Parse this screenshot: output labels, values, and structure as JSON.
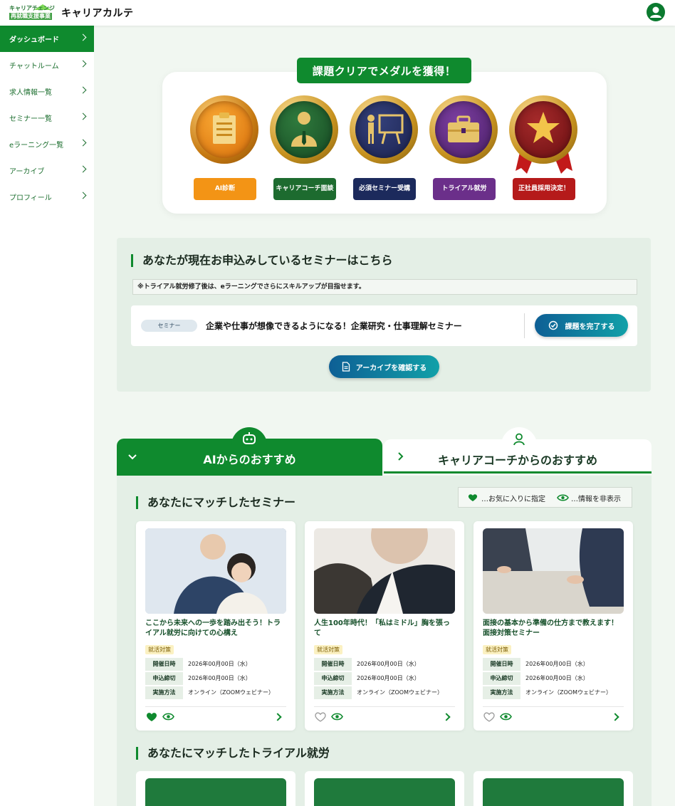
{
  "header": {
    "logo_line1": "キャリアチェンジ",
    "logo_line2": "再就職支援事業",
    "app_title": "キャリアカルテ"
  },
  "sidebar": {
    "items": [
      {
        "label": "ダッシュボード",
        "active": true
      },
      {
        "label": "チャットルーム"
      },
      {
        "label": "求人情報一覧"
      },
      {
        "label": "セミナー一覧"
      },
      {
        "label": "eラーニング一覧"
      },
      {
        "label": "アーカイブ"
      },
      {
        "label": "プロフィール"
      }
    ]
  },
  "medals": {
    "title": "課題クリアでメダルを獲得！",
    "items": [
      {
        "label": "AI診断",
        "color": "#f39415",
        "icon": "clipboard-icon"
      },
      {
        "label": "キャリアコーチ面談",
        "color": "#1d6b2f",
        "icon": "coach-icon"
      },
      {
        "label": "必須セミナー受講",
        "color": "#1c2a5c",
        "icon": "presentation-icon"
      },
      {
        "label": "トライアル就労",
        "color": "#6b2f8a",
        "icon": "briefcase-icon"
      },
      {
        "label": "正社員採用決定！",
        "color": "#b51a1a",
        "icon": "star-icon"
      }
    ]
  },
  "seminar_section": {
    "heading": "あなたが現在お申込みしているセミナーはこちら",
    "notice": "※トライアル就労修了後は、eラーニングでさらにスキルアップが目指せます。",
    "pill": "セミナー",
    "title": "企業や仕事が想像できるようになる！企業研究・仕事理解セミナー",
    "complete_button": "課題を完了する",
    "archive_button": "アーカイブを確認する"
  },
  "tabs": {
    "ai": "AIからのおすすめ",
    "coach": "キャリアコーチからのおすすめ"
  },
  "recommend": {
    "heading": "あなたにマッチしたセミナー",
    "legend_fav": "…お気に入りに指定",
    "legend_hide": "…情報を非表示",
    "meta_keys": [
      "開催日時",
      "申込締切",
      "実施方法"
    ],
    "cards": [
      {
        "title": "ここから未来への一歩を踏み出そう！トライアル就労に向けての心構え",
        "tag": "就活対策",
        "date": "2026年00月00日（水）",
        "deadline": "2026年00月00日（水）",
        "method": "オンライン（ZOOMウェビナー）",
        "favorite": true
      },
      {
        "title": "人生100年時代！「私はミドル」胸を張って",
        "tag": "就活対策",
        "date": "2026年00月00日（水）",
        "deadline": "2026年00月00日（水）",
        "method": "オンライン（ZOOMウェビナー）",
        "favorite": false
      },
      {
        "title": "面接の基本から準備の仕方まで教えます！ 面接対策セミナー",
        "tag": "就活対策",
        "date": "2026年00月00日（水）",
        "deadline": "2026年00月00日（水）",
        "method": "オンライン（ZOOMウェビナー）",
        "favorite": false
      }
    ],
    "heading2": "あなたにマッチしたトライアル就労"
  },
  "colors": {
    "primary": "#0f8a2e",
    "blue_button": "#0e5f95"
  }
}
